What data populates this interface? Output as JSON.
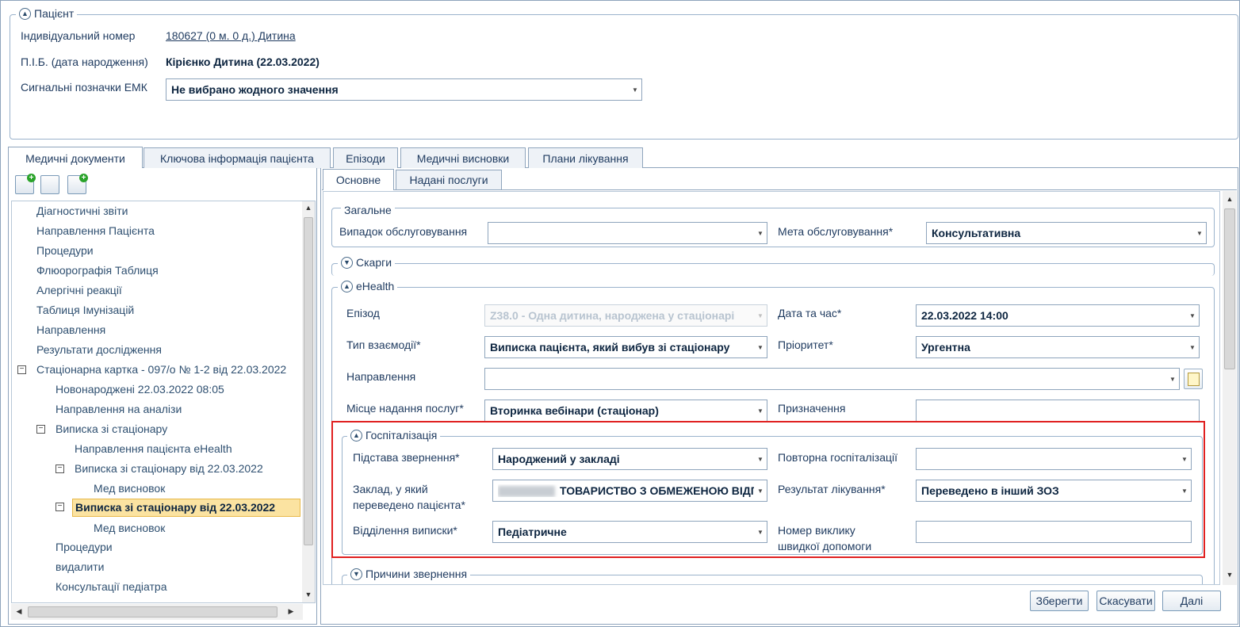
{
  "patient": {
    "title": "Пацієнт",
    "id_label": "Індивідуальний номер",
    "id_value": "180627 (0 м. 0 д.) Дитина",
    "name_label": "П.І.Б. (дата народження)",
    "name_value": "Кірієнко Дитина (22.03.2022)",
    "signal_label": "Сигнальні позначки ЕМК",
    "signal_value": "Не вибрано жодного значення"
  },
  "main_tabs": [
    "Медичні документи",
    "Ключова інформація пацієнта",
    "Епізоди",
    "Медичні висновки",
    "Плани лікування"
  ],
  "tree": {
    "items": [
      "Діагностичні звіти",
      "Направлення Пацієнта",
      "Процедури",
      "Флюорографія Таблиця",
      "Алергічні реакції",
      "Таблиця Імунізацій",
      "Направлення",
      "Результати дослідження",
      "Стаціонарна картка - 097/о № 1-2 від 22.03.2022",
      "Новонароджені 22.03.2022 08:05",
      "Направлення на аналізи",
      "Виписка зі стаціонару",
      "Направлення пацієнта eHealth",
      "Виписка зі стаціонару від 22.03.2022",
      "Мед висновок",
      "Виписка зі стаціонару від 22.03.2022",
      "Мед висновок",
      "Процедури",
      "видалити",
      "Консультації педіатра"
    ]
  },
  "sub_tabs": [
    "Основне",
    "Надані послуги"
  ],
  "general": {
    "title": "Загальне",
    "case_label": "Випадок обслуговування",
    "case_value": "",
    "purpose_label": "Мета обслуговування*",
    "purpose_value": "Консультативна"
  },
  "complaints": {
    "title": "Скарги"
  },
  "ehealth": {
    "title": "eHealth",
    "episode_label": "Епізод",
    "episode_value": "Z38.0 - Одна дитина, народжена у стаціонарі",
    "datetime_label": "Дата та час*",
    "datetime_value": "22.03.2022 14:00",
    "interaction_label": "Тип взаємодії*",
    "interaction_value": "Виписка пацієнта, який вибув зі стаціонару",
    "priority_label": "Пріоритет*",
    "priority_value": "Ургентна",
    "referral_label": "Направлення",
    "referral_value": "",
    "place_label": "Місце надання послуг*",
    "place_value": "Вторинка вебінари (стаціонар)",
    "assignment_label": "Призначення",
    "assignment_value": ""
  },
  "hospitalization": {
    "title": "Госпіталізація",
    "reason_label": "Підстава звернення*",
    "reason_value": "Народжений у закладі",
    "repeat_label": "Повторна госпіталізації",
    "repeat_value": "",
    "transfer_label_1": "Заклад, у який",
    "transfer_label_2": "переведено пацієнта*",
    "transfer_value": "ТОВАРИСТВО З ОБМЕЖЕНОЮ ВІДПОВІДАЛЬНІСТЮ",
    "result_label": "Результат лікування*",
    "result_value": "Переведено в інший ЗОЗ",
    "dept_label": "Відділення виписки*",
    "dept_value": "Педіатричне",
    "ambulance_label_1": "Номер виклику",
    "ambulance_label_2": "швидкої допомоги",
    "ambulance_value": ""
  },
  "reasons": {
    "title": "Причини звернення"
  },
  "buttons": {
    "save": "Зберегти",
    "cancel": "Скасувати",
    "next": "Далі"
  }
}
